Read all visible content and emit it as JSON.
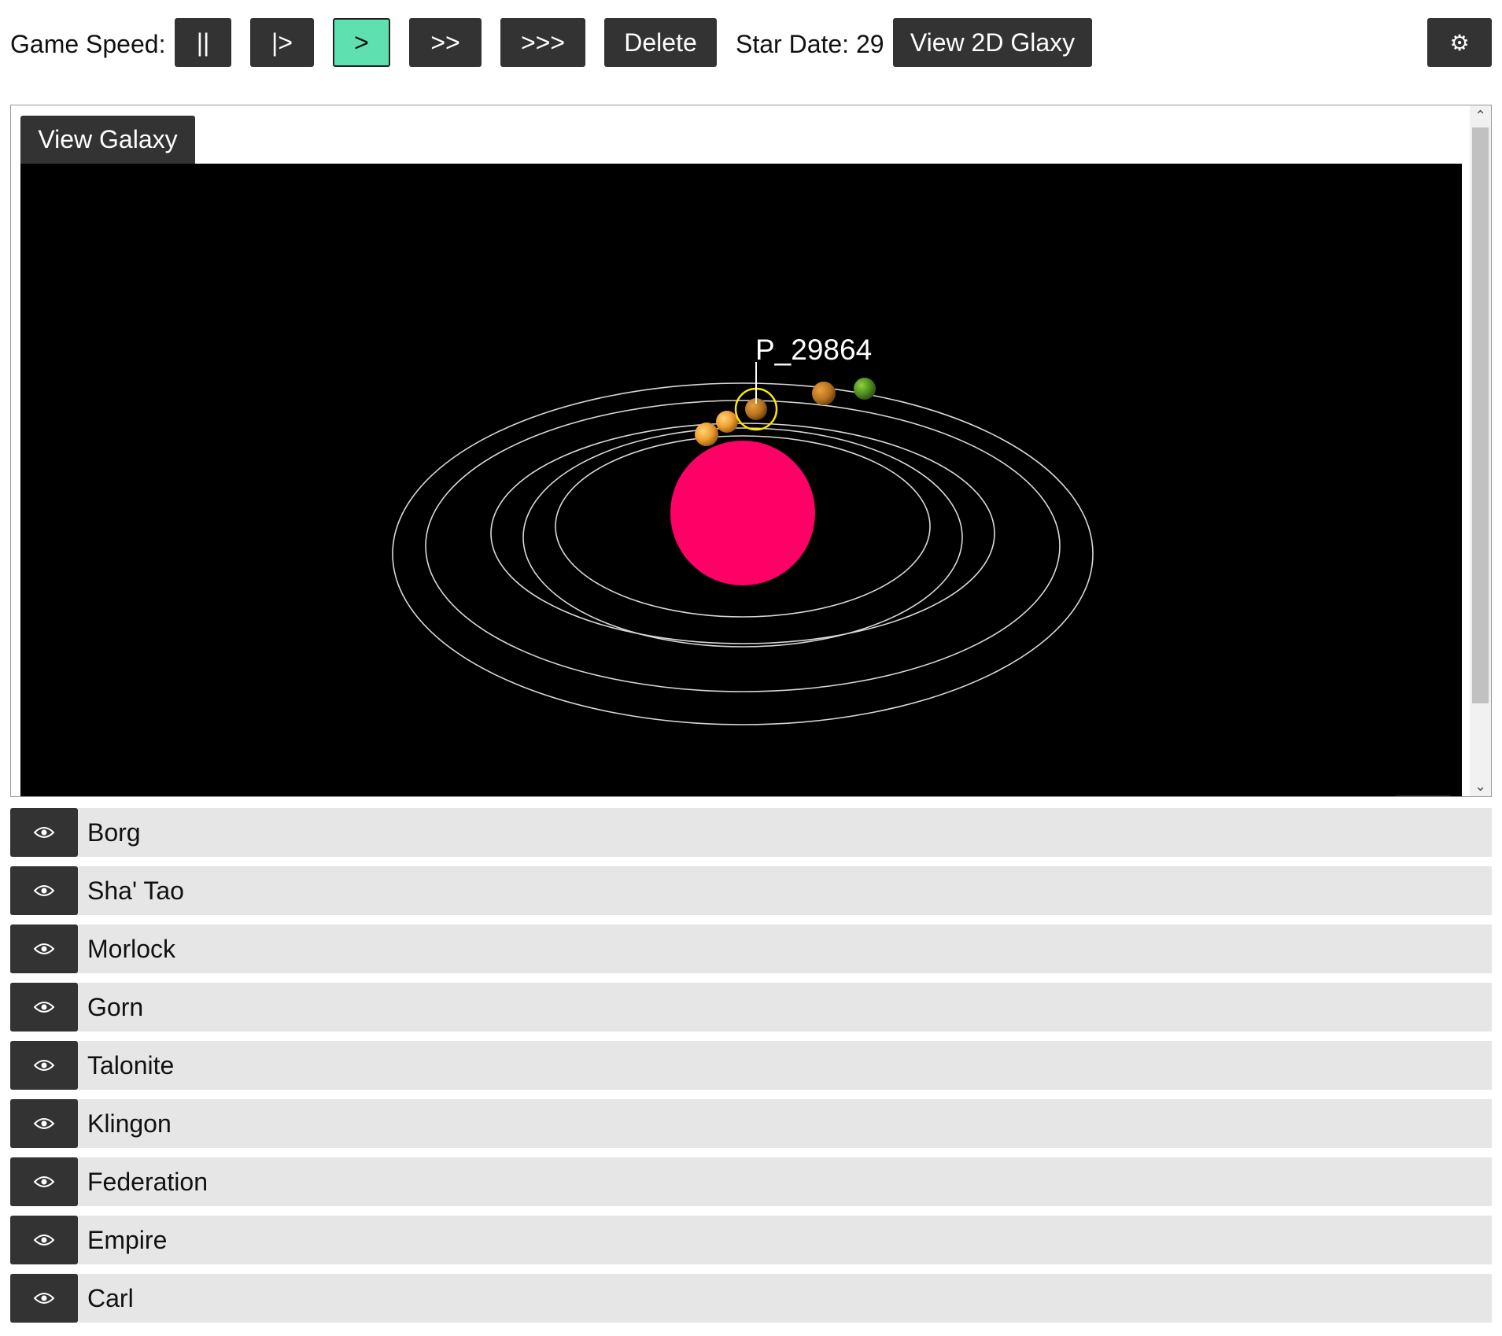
{
  "toolbar": {
    "game_speed_label": "Game Speed:",
    "speed_buttons": [
      {
        "label": "||",
        "active": false
      },
      {
        "label": "|>",
        "active": false
      },
      {
        "label": ">",
        "active": true
      },
      {
        "label": ">>",
        "active": false
      },
      {
        "label": ">>>",
        "active": false
      }
    ],
    "delete_label": "Delete",
    "star_date_label": "Star Date: 29",
    "view_2d_label": "View 2D Glaxy",
    "settings_icon": "gear-icon",
    "settings_glyph": "⚙"
  },
  "viewer": {
    "tab_label": "View Galaxy",
    "selected_planet_label": "P_29864",
    "zoom_label": "+",
    "scroll_up_glyph": "⌃",
    "scroll_down_glyph": "⌄"
  },
  "colors": {
    "star": "#ff0066",
    "active_speed": "#5fe0b0",
    "button_bg": "#333333",
    "selection_ring": "#ffe600",
    "row_bg": "#e6e6e6"
  },
  "factions": [
    {
      "name": "Borg",
      "icon": "eye-icon"
    },
    {
      "name": "Sha' Tao",
      "icon": "eye-icon"
    },
    {
      "name": "Morlock",
      "icon": "eye-icon"
    },
    {
      "name": "Gorn",
      "icon": "eye-icon"
    },
    {
      "name": "Talonite",
      "icon": "eye-icon"
    },
    {
      "name": "Klingon",
      "icon": "eye-icon"
    },
    {
      "name": "Federation",
      "icon": "eye-icon"
    },
    {
      "name": "Empire",
      "icon": "eye-icon"
    },
    {
      "name": "Carl",
      "icon": "eye-icon"
    }
  ]
}
